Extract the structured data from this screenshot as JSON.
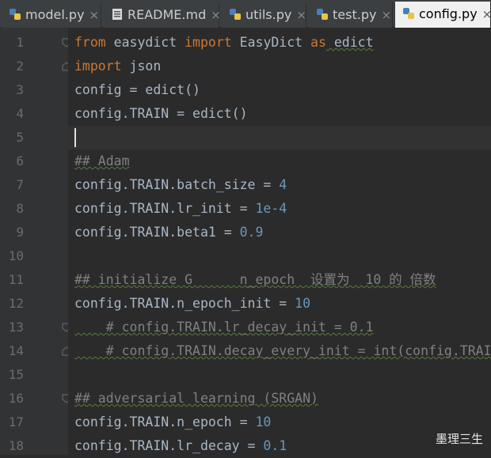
{
  "tabs": [
    {
      "label": "model.py",
      "active": false,
      "icon": "python-file-icon"
    },
    {
      "label": "README.md",
      "active": false,
      "icon": "markdown-file-icon"
    },
    {
      "label": "utils.py",
      "active": false,
      "icon": "python-file-icon"
    },
    {
      "label": "test.py",
      "active": false,
      "icon": "python-file-icon"
    },
    {
      "label": "config.py",
      "active": true,
      "icon": "python-file-icon"
    }
  ],
  "close_glyph": "×",
  "lines": [
    {
      "no": "1",
      "tokens": [
        {
          "t": "from",
          "c": "kw"
        },
        {
          "t": " easydict ",
          "c": ""
        },
        {
          "t": "import",
          "c": "kw"
        },
        {
          "t": " EasyDict ",
          "c": ""
        },
        {
          "t": "as",
          "c": "kw"
        },
        {
          "t": " edict",
          "c": "wavy"
        }
      ]
    },
    {
      "no": "2",
      "tokens": [
        {
          "t": "import",
          "c": "kw"
        },
        {
          "t": " json",
          "c": ""
        }
      ]
    },
    {
      "no": "3",
      "tokens": [
        {
          "t": "config = edict()",
          "c": ""
        }
      ]
    },
    {
      "no": "4",
      "tokens": [
        {
          "t": "config.TRAIN = edict()",
          "c": ""
        }
      ]
    },
    {
      "no": "5",
      "tokens": []
    },
    {
      "no": "6",
      "tokens": [
        {
          "t": "## Adam",
          "c": "com wavy"
        }
      ]
    },
    {
      "no": "7",
      "tokens": [
        {
          "t": "config.TRAIN.batch_size = ",
          "c": ""
        },
        {
          "t": "4",
          "c": "num"
        }
      ]
    },
    {
      "no": "8",
      "tokens": [
        {
          "t": "config.TRAIN.lr_init = ",
          "c": ""
        },
        {
          "t": "1e-4",
          "c": "num"
        }
      ]
    },
    {
      "no": "9",
      "tokens": [
        {
          "t": "config.TRAIN.beta1 = ",
          "c": ""
        },
        {
          "t": "0.9",
          "c": "num"
        }
      ]
    },
    {
      "no": "10",
      "tokens": []
    },
    {
      "no": "11",
      "tokens": [
        {
          "t": "## initialize G      n_epoch  设置为  10 的 倍数",
          "c": "com wavy"
        }
      ]
    },
    {
      "no": "12",
      "tokens": [
        {
          "t": "config.TRAIN.n_epoch_init = ",
          "c": ""
        },
        {
          "t": "10",
          "c": "num"
        }
      ]
    },
    {
      "no": "13",
      "tokens": [
        {
          "t": "    # config.TRAIN.lr_decay_init = 0.1",
          "c": "com wavy"
        }
      ]
    },
    {
      "no": "14",
      "tokens": [
        {
          "t": "    # config.TRAIN.decay_every_init = int(config.TRAIN",
          "c": "com wavy"
        }
      ]
    },
    {
      "no": "15",
      "tokens": []
    },
    {
      "no": "16",
      "tokens": [
        {
          "t": "## adversarial learning (SRGAN)",
          "c": "com wavy"
        }
      ]
    },
    {
      "no": "17",
      "tokens": [
        {
          "t": "config.TRAIN.n_epoch = ",
          "c": ""
        },
        {
          "t": "10",
          "c": "num"
        }
      ]
    },
    {
      "no": "18",
      "tokens": [
        {
          "t": "config.TRAIN.lr_decay = ",
          "c": ""
        },
        {
          "t": "0.1",
          "c": "num"
        }
      ]
    }
  ],
  "watermark": "墨理三生",
  "colors": {
    "keyword": "#cc7832",
    "number": "#6897bb",
    "comment": "#808080",
    "text": "#a9b7c6",
    "background": "#2b2b2b"
  }
}
